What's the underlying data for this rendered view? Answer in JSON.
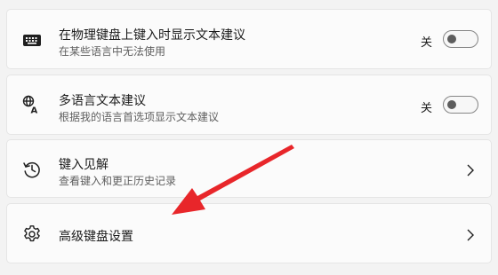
{
  "settings": [
    {
      "title": "在物理键盘上键入时显示文本建议",
      "subtitle": "在某些语言中无法使用",
      "state": "关",
      "toggle_on": false,
      "icon": "keyboard-icon"
    },
    {
      "title": "多语言文本建议",
      "subtitle": "根据我的语言首选项显示文本建议",
      "state": "关",
      "toggle_on": false,
      "icon": "language-icon"
    },
    {
      "title": "键入见解",
      "subtitle": "查看键入和更正历史记录",
      "icon": "history-icon"
    },
    {
      "title": "高级键盘设置",
      "icon": "gear-icon"
    }
  ],
  "colors": {
    "background": "#f3f3f3",
    "card": "#fbfbfb",
    "annotation_arrow": "#e8262a"
  }
}
